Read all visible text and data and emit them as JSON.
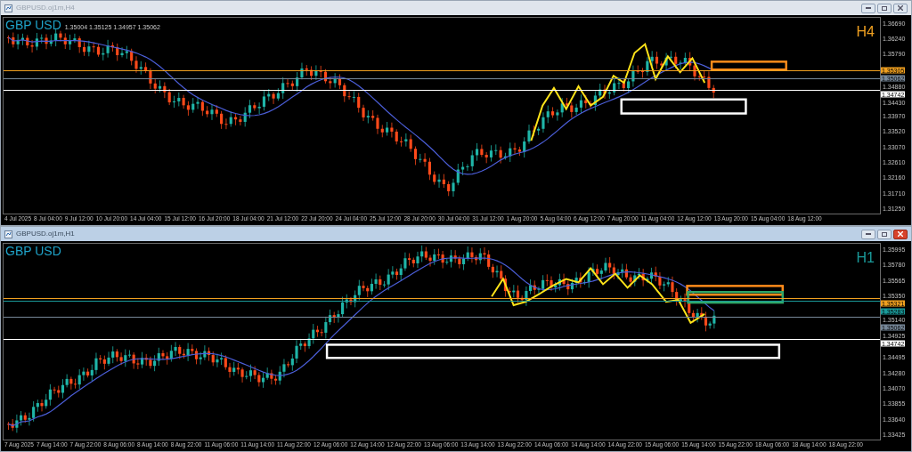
{
  "windows": [
    {
      "kind": "h4",
      "title": "GBPUSD.oj1m,H4",
      "active": false,
      "symbol": "GBP USD",
      "quote": "1.35004 1.35125 1.34957 1.35062",
      "timeframe": "H4",
      "price_ticks": [
        "1.36690",
        "1.36240",
        "1.35790",
        "1.34880",
        "1.34430",
        "1.33970",
        "1.33520",
        "1.33070",
        "1.32610",
        "1.32160",
        "1.31710",
        "1.31250"
      ],
      "price_markers": [
        {
          "label": "1.35305",
          "color": "#f0a020"
        },
        {
          "label": "1.35062",
          "color": "#778899"
        },
        {
          "label": "1.34742",
          "color": "#ffffff"
        }
      ],
      "time_labels": [
        "4 Jul 2025",
        "8 Jul 04:00",
        "9 Jul 12:00",
        "10 Jul 20:00",
        "14 Jul 04:00",
        "15 Jul 12:00",
        "16 Jul 20:00",
        "18 Jul 04:00",
        "21 Jul 12:00",
        "22 Jul 20:00",
        "24 Jul 04:00",
        "25 Jul 12:00",
        "28 Jul 20:00",
        "30 Jul 04:00",
        "31 Jul 12:00",
        "1 Aug 20:00",
        "5 Aug 04:00",
        "6 Aug 12:00",
        "7 Aug 20:00",
        "11 Aug 04:00",
        "12 Aug 12:00",
        "13 Aug 20:00",
        "15 Aug 04:00",
        "18 Aug 12:00"
      ]
    },
    {
      "kind": "h1",
      "title": "GBPUSD.oj1m,H1",
      "active": true,
      "symbol": "GBP USD",
      "timeframe": "H1",
      "price_ticks": [
        "1.35995",
        "1.35780",
        "1.35565",
        "1.35350",
        "1.35140",
        "1.34925",
        "1.34495",
        "1.34280",
        "1.34070",
        "1.33855",
        "1.33640",
        "1.33425"
      ],
      "price_markers": [
        {
          "label": "1.35321",
          "color": "#f0a020"
        },
        {
          "label": "1.35283",
          "color": "#1a9a9a"
        },
        {
          "label": "1.35062",
          "color": "#778899"
        },
        {
          "label": "1.34742",
          "color": "#ffffff"
        }
      ],
      "time_labels": [
        "7 Aug 2025",
        "7 Aug 14:00",
        "7 Aug 22:00",
        "8 Aug 06:00",
        "8 Aug 14:00",
        "8 Aug 22:00",
        "11 Aug 06:00",
        "11 Aug 14:00",
        "11 Aug 22:00",
        "12 Aug 06:00",
        "12 Aug 14:00",
        "12 Aug 22:00",
        "13 Aug 06:00",
        "13 Aug 14:00",
        "13 Aug 22:00",
        "14 Aug 06:00",
        "14 Aug 14:00",
        "14 Aug 22:00",
        "15 Aug 06:00",
        "15 Aug 14:00",
        "15 Aug 22:00",
        "18 Aug 06:00",
        "18 Aug 14:00",
        "18 Aug 22:00"
      ]
    }
  ]
}
